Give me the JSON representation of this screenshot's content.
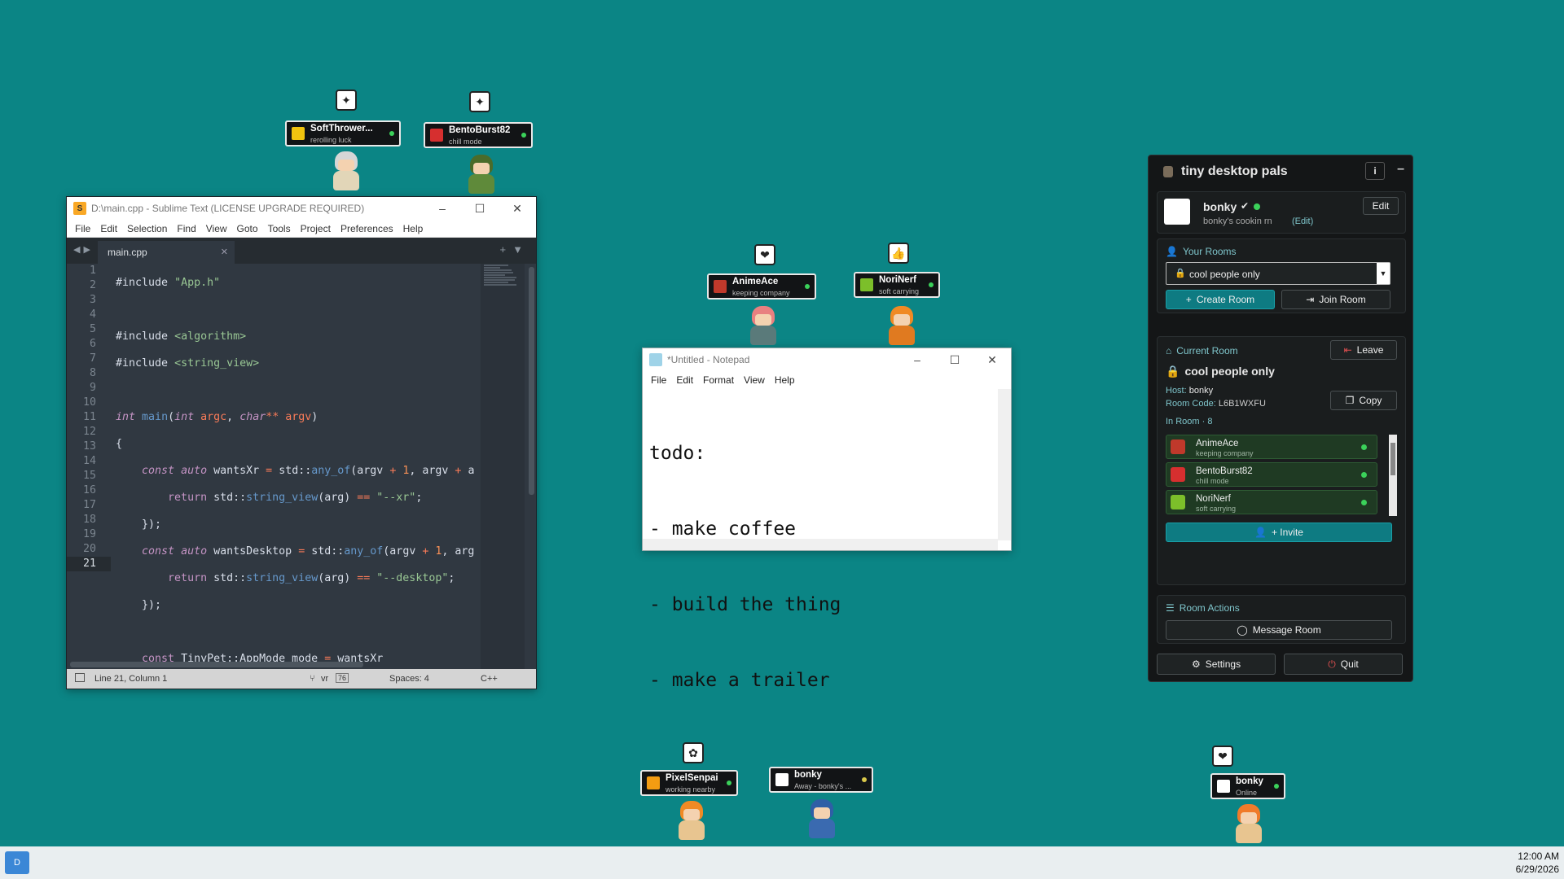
{
  "sublime": {
    "title": "D:\\main.cpp - Sublime Text (LICENSE UPGRADE REQUIRED)",
    "menu": [
      "File",
      "Edit",
      "Selection",
      "Find",
      "View",
      "Goto",
      "Tools",
      "Project",
      "Preferences",
      "Help"
    ],
    "tab": "main.cpp",
    "line_numbers": [
      "1",
      "2",
      "3",
      "4",
      "5",
      "6",
      "7",
      "8",
      "9",
      "10",
      "11",
      "12",
      "13",
      "14",
      "15",
      "16",
      "17",
      "18",
      "19",
      "20",
      "21"
    ],
    "status": {
      "position": "Line 21, Column 1",
      "branch": "vr",
      "branch_count": "76",
      "spaces": "Spaces: 4",
      "syntax": "C++"
    }
  },
  "notepad": {
    "title": "*Untitled - Notepad",
    "menu": [
      "File",
      "Edit",
      "Format",
      "View",
      "Help"
    ],
    "lines": [
      "todo:",
      "- make coffee",
      "- build the thing",
      "- make a trailer"
    ]
  },
  "panel": {
    "title": "tiny desktop pals",
    "user": {
      "name": "bonky",
      "status": "bonky's cookin rn",
      "edit_link": "(Edit)",
      "edit_button": "Edit"
    },
    "your_rooms": {
      "label": "Your Rooms",
      "selected": "cool people only",
      "create": "Create Room",
      "join": "Join Room"
    },
    "current_room": {
      "label": "Current Room",
      "leave": "Leave",
      "name": "cool people only",
      "host_label": "Host:",
      "host": "bonky",
      "code_label": "Room Code:",
      "code": "L6B1WXFU",
      "copy": "Copy",
      "in_room_label": "In Room",
      "in_room_count": "8",
      "members": [
        {
          "name": "AnimeAce",
          "status": "keeping company",
          "color": "#c0392b"
        },
        {
          "name": "BentoBurst82",
          "status": "chill mode",
          "color": "#d62f2f"
        },
        {
          "name": "NoriNerf",
          "status": "soft carrying",
          "color": "#7cbf2a"
        }
      ],
      "invite": "+ Invite"
    },
    "actions": {
      "label": "Room Actions",
      "message": "Message Room"
    },
    "settings": "Settings",
    "quit": "Quit"
  },
  "pets": [
    {
      "name": "SoftThrower...",
      "status": "rerolling luck",
      "bubble": "✦",
      "hair": "#d6d6d6",
      "body": "#e2d6b8",
      "avatar": "#f1c40f"
    },
    {
      "name": "BentoBurst82",
      "status": "chill mode",
      "bubble": "✦",
      "hair": "#4a6b2a",
      "body": "#5f8a3a",
      "avatar": "#d62f2f"
    },
    {
      "name": "AnimeAce",
      "status": "keeping company",
      "bubble": "❤",
      "hair": "#e88080",
      "body": "#5a7a7a",
      "avatar": "#c0392b"
    },
    {
      "name": "NoriNerf",
      "status": "soft carrying",
      "bubble": "👍",
      "hair": "#f08a24",
      "body": "#e07a20",
      "avatar": "#7cbf2a"
    },
    {
      "name": "PixelSenpai",
      "status": "working nearby",
      "bubble": "✿",
      "hair": "#f08a24",
      "body": "#e8c590",
      "avatar": "#f39c12"
    },
    {
      "name": "bonky",
      "status": "Away - bonky's ...",
      "bubble": "",
      "hair": "#2f5fa6",
      "body": "#3a6ab0",
      "avatar": "#ffffff"
    },
    {
      "name": "bonky",
      "status": "Online",
      "bubble": "❤",
      "hair": "#f07b2a",
      "body": "#e8c590",
      "avatar": "#ffffff"
    }
  ],
  "taskbar": {
    "icon_label": "D",
    "time": "12:00 AM",
    "date": "6/29/2026"
  }
}
